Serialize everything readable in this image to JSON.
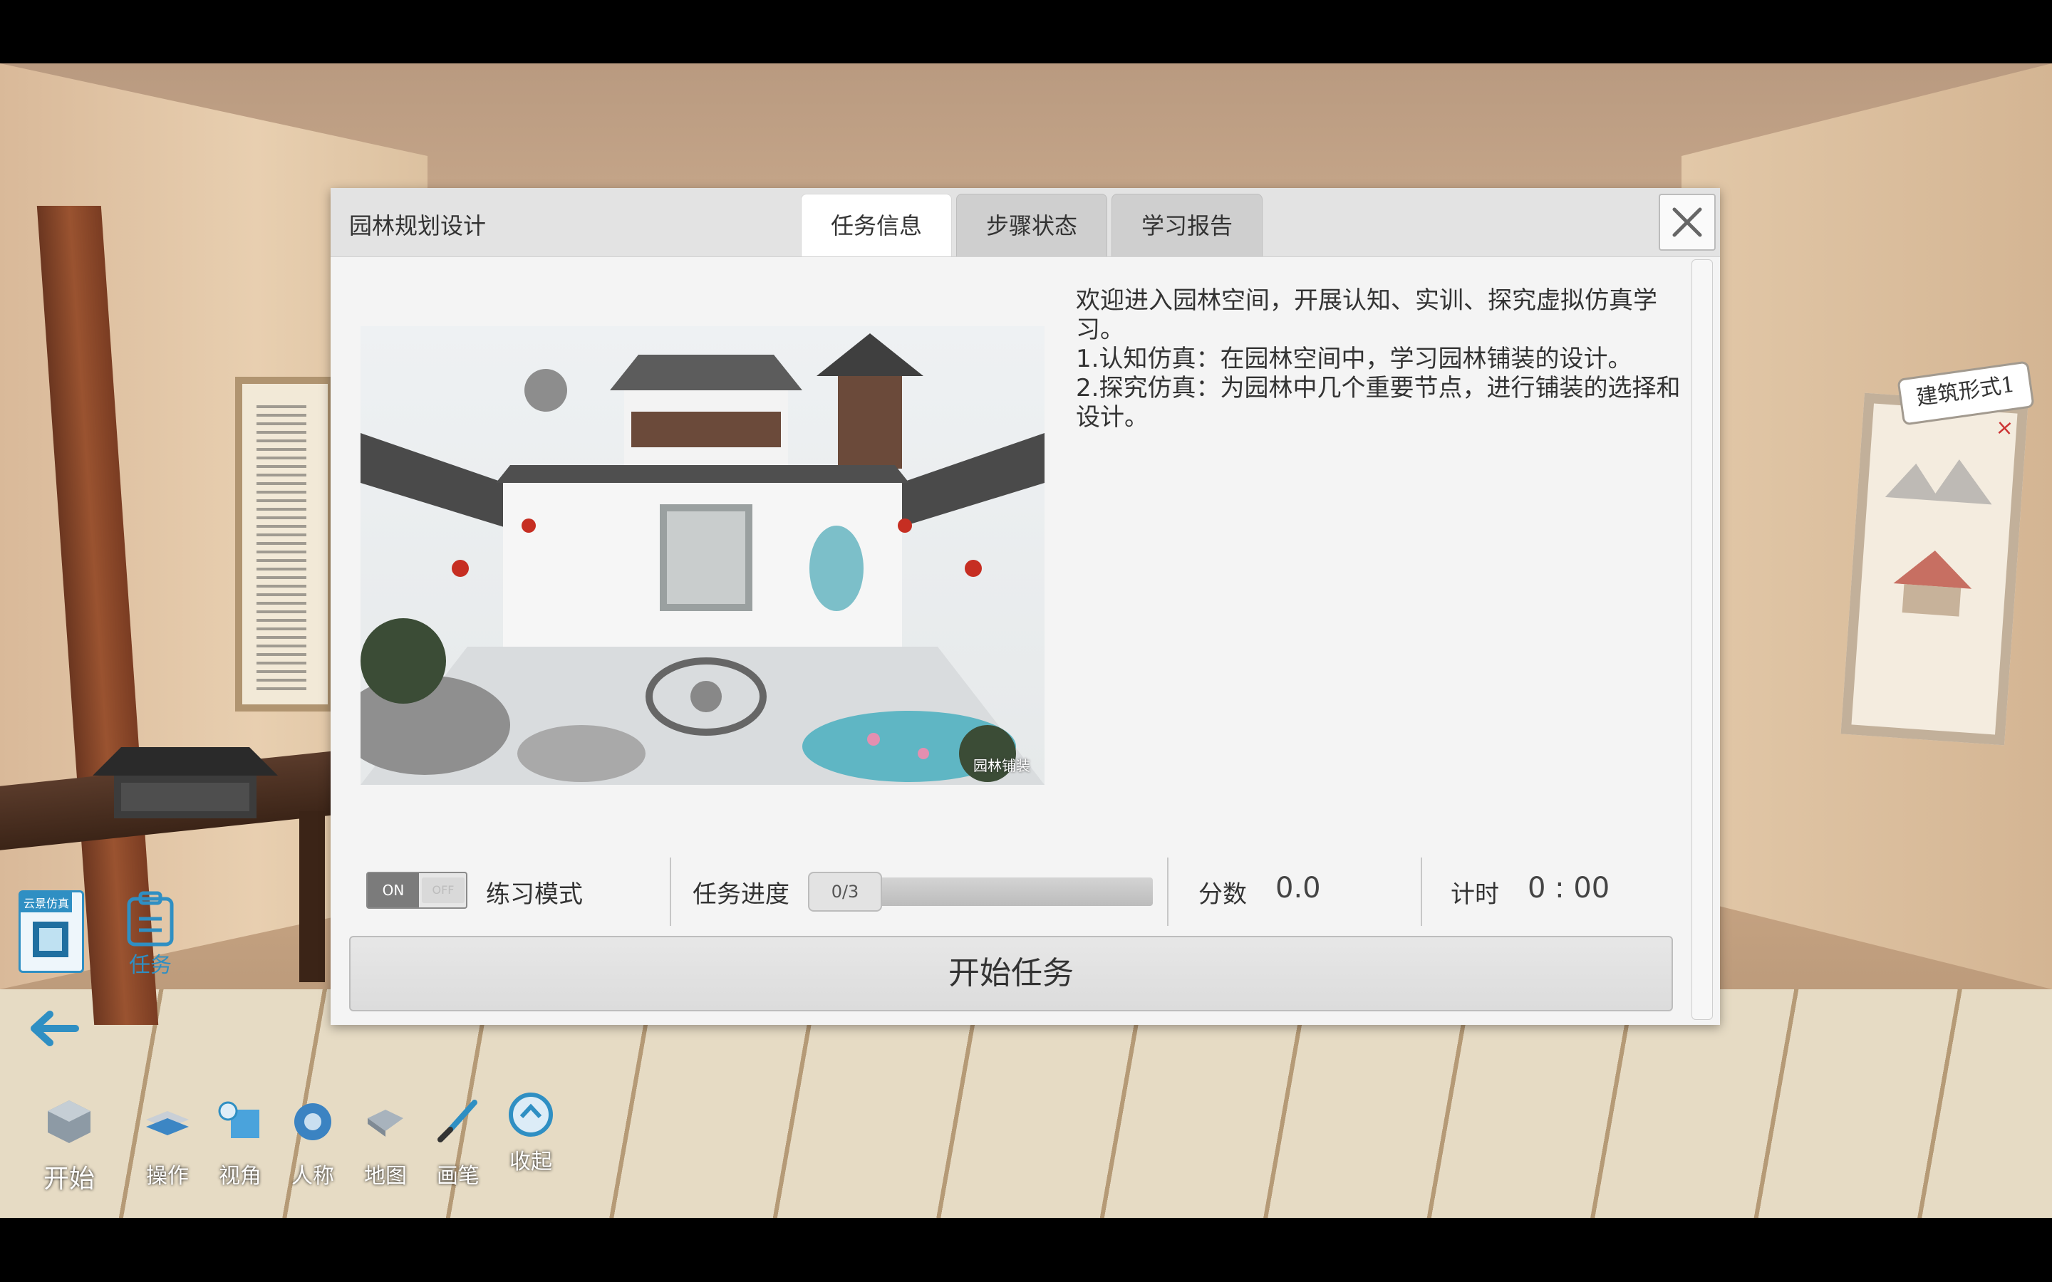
{
  "dialog": {
    "title": "园林规划设计",
    "tabs": [
      {
        "label": "任务信息",
        "active": true
      },
      {
        "label": "步骤状态",
        "active": false
      },
      {
        "label": "学习报告",
        "active": false
      }
    ],
    "close_icon": "close-icon",
    "image_caption": "园林铺装",
    "description": [
      "欢迎进入园林空间，开展认知、实训、探究虚拟仿真学习。",
      "1.认知仿真：在园林空间中，学习园林铺装的设计。",
      "2.探究仿真：为园林中几个重要节点，进行铺装的选择和设计。"
    ],
    "practice_toggle": {
      "on_label": "ON",
      "off_label": "OFF",
      "state": "on"
    },
    "practice_label": "练习模式",
    "progress_label": "任务进度",
    "progress_value": "0/3",
    "progress_fraction": 0,
    "score_label": "分数",
    "score_value": "0.0",
    "timer_label": "计时",
    "timer_value": "0 : 00",
    "start_button": "开始任务"
  },
  "scene": {
    "sign_text": "建筑形式1",
    "scroll_mark": "×"
  },
  "side_panel": {
    "sim_badge": "云景仿真",
    "task_label": "任务",
    "back_icon": "back-arrow-icon"
  },
  "toolbar": [
    {
      "label": "开始",
      "icon": "start-cube-icon"
    },
    {
      "label": "操作",
      "icon": "operate-layers-icon"
    },
    {
      "label": "视角",
      "icon": "view-angle-icon"
    },
    {
      "label": "人称",
      "icon": "person-view-icon"
    },
    {
      "label": "地图",
      "icon": "map-icon"
    },
    {
      "label": "画笔",
      "icon": "paint-brush-icon"
    },
    {
      "label": "收起",
      "icon": "collapse-icon"
    }
  ],
  "colors": {
    "accent": "#2f8fc3",
    "dialog_bg": "#f4f4f4",
    "header_bg": "#e3e3e3"
  }
}
